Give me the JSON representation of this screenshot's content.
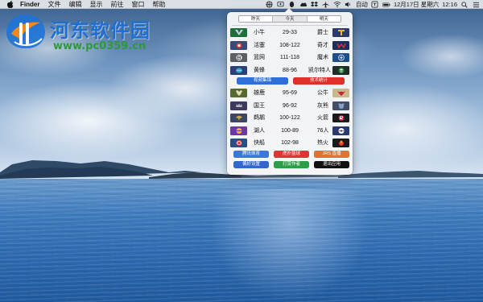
{
  "watermark": {
    "title": "河东软件园",
    "url": "www.pc0359.cn"
  },
  "menubar": {
    "app_name": "Finder",
    "items": [
      "文件",
      "编辑",
      "显示",
      "前往",
      "窗口",
      "帮助"
    ],
    "status": {
      "input_mode": "自动",
      "datetime": "12月17日 星期六",
      "time": "12:16"
    }
  },
  "popover": {
    "tabs": [
      "昨天",
      "今天",
      "明天"
    ],
    "active_tab": "今天",
    "group1": [
      {
        "home": "小牛",
        "score": "29-33",
        "away": "爵士",
        "home_color": "#1f6f3a",
        "away_color": "#2b3a6e"
      },
      {
        "home": "活塞",
        "score": "108-122",
        "away": "奇才",
        "home_color": "#3a4a78",
        "away_color": "#1b2f5e"
      },
      {
        "home": "篮网",
        "score": "111-118",
        "away": "魔术",
        "home_color": "#5b5f66",
        "away_color": "#1d4f8a"
      },
      {
        "home": "黄蜂",
        "score": "88-96",
        "away": "凯尔特人",
        "home_color": "#2b3f7a",
        "away_color": "#1f2e28"
      }
    ],
    "mid_buttons": {
      "left": "视频集锦",
      "right": "技术统计",
      "left_color": "#2f6fd8",
      "right_color": "#e0302a"
    },
    "group2": [
      {
        "home": "雄鹿",
        "score": "95-69",
        "away": "公牛",
        "home_color": "#556b2f",
        "away_color": "#c9b98a"
      },
      {
        "home": "国王",
        "score": "96-92",
        "away": "灰熊",
        "home_color": "#3d3a5e",
        "away_color": "#3e4e66"
      },
      {
        "home": "鹈鹕",
        "score": "100-122",
        "away": "火箭",
        "home_color": "#3c4660",
        "away_color": "#1a1a1a"
      },
      {
        "home": "湖人",
        "score": "100-89",
        "away": "76人",
        "home_color": "#6a3aa0",
        "away_color": "#2a3b72"
      },
      {
        "home": "快船",
        "score": "102-98",
        "away": "热火",
        "home_color": "#2a4e86",
        "away_color": "#1b1b1b"
      }
    ],
    "bottom_buttons": [
      {
        "label": "腾讯体育",
        "color": "#3c77dd"
      },
      {
        "label": "虎扑篮球",
        "color": "#de3535"
      },
      {
        "label": "JRS 直播",
        "color": "#e2732a"
      },
      {
        "label": "偏好设置",
        "color": "#3366cc"
      },
      {
        "label": "打赏作者",
        "color": "#2d9e47"
      },
      {
        "label": "退出应用",
        "color": "#111111"
      }
    ]
  }
}
